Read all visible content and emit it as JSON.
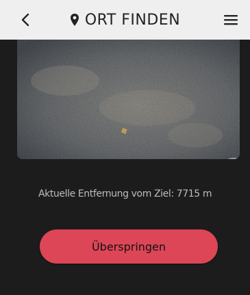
{
  "header": {
    "title": "ORT FINDEN",
    "back_icon": "chevron-left-icon",
    "location_icon": "map-pin-icon",
    "menu_icon": "hamburger-menu-icon"
  },
  "photo": {
    "zoom_icon": "magnifier-icon"
  },
  "status": {
    "distance_text": "Aktuelle Entfernung vom Ziel: 7715 m"
  },
  "actions": {
    "skip_label": "Überspringen"
  },
  "colors": {
    "header_bg": "#efefef",
    "page_bg": "#1c1c1c",
    "accent": "#dc4657"
  }
}
